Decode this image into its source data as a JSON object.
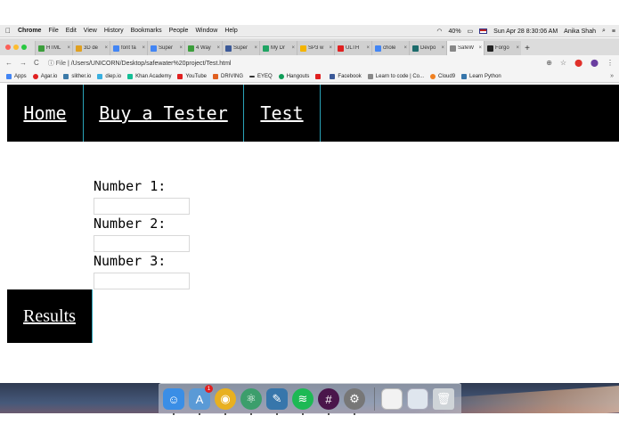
{
  "menubar": {
    "apple": "",
    "app": "Chrome",
    "items": [
      "File",
      "Edit",
      "View",
      "History",
      "Bookmarks",
      "People",
      "Window",
      "Help"
    ],
    "battery": "40%",
    "datetime": "Sun Apr 28  8:30:06 AM",
    "user": "Anika Shah"
  },
  "tabs": [
    {
      "label": "HTML",
      "color": "#3c9e3c"
    },
    {
      "label": "3D de",
      "color": "#e0a020"
    },
    {
      "label": "font fa",
      "color": "#4285f4"
    },
    {
      "label": "Super",
      "color": "#4285f4"
    },
    {
      "label": "4 Way",
      "color": "#3c9e3c"
    },
    {
      "label": "Super",
      "color": "#3b5998"
    },
    {
      "label": "My Dr",
      "color": "#1fa463"
    },
    {
      "label": "SP3 w",
      "color": "#f4b400"
    },
    {
      "label": "ULTH",
      "color": "#e02020"
    },
    {
      "label": "chole",
      "color": "#4285f4"
    },
    {
      "label": "Devpo",
      "color": "#1c6b6b"
    },
    {
      "label": "SafeW",
      "color": "#888888"
    },
    {
      "label": "Forgo",
      "color": "#222222"
    }
  ],
  "address": {
    "scheme": "File",
    "url": "/Users/UNICORN/Desktop/safewater%20project/Test.html"
  },
  "bookmarks": [
    {
      "label": "Apps",
      "color": "#4285f4"
    },
    {
      "label": "Agar.io",
      "color": "#e02020"
    },
    {
      "label": "slither.io",
      "color": "#3c7aa8"
    },
    {
      "label": "diep.io",
      "color": "#3ab0e0"
    },
    {
      "label": "Khan Academy",
      "color": "#14bf96"
    },
    {
      "label": "YouTube",
      "color": "#e02020"
    },
    {
      "label": "DRIVING",
      "color": "#e06020"
    },
    {
      "label": "EYEQ",
      "color": "#333333"
    },
    {
      "label": "Hangouts",
      "color": "#0f9d58"
    },
    {
      "label": "",
      "color": "#e02020"
    },
    {
      "label": "Facebook",
      "color": "#3b5998"
    },
    {
      "label": "Learn to code | Co...",
      "color": "#888888"
    },
    {
      "label": "Cloud9",
      "color": "#f08020"
    },
    {
      "label": "Learn Python",
      "color": "#3776ab"
    }
  ],
  "nav": {
    "home": "Home",
    "buy": "Buy a Tester",
    "test": "Test"
  },
  "form": {
    "label1": "Number 1:",
    "label2": "Number 2:",
    "label3": "Number 3:",
    "value1": "",
    "value2": "",
    "value3": ""
  },
  "results_label": "Results",
  "dock_apps": [
    {
      "name": "finder-icon",
      "color": "#3a8ee6"
    },
    {
      "name": "app-store-icon",
      "color": "#5a9ad6"
    },
    {
      "name": "chrome-icon",
      "color": "#e8b020"
    },
    {
      "name": "atom-icon",
      "color": "#3c9e6c"
    },
    {
      "name": "python-icon",
      "color": "#3776ab"
    },
    {
      "name": "spotify-icon",
      "color": "#1db954"
    },
    {
      "name": "slack-icon",
      "color": "#4a154b"
    },
    {
      "name": "system-preferences-icon",
      "color": "#777777"
    }
  ],
  "dock_badge": "1"
}
